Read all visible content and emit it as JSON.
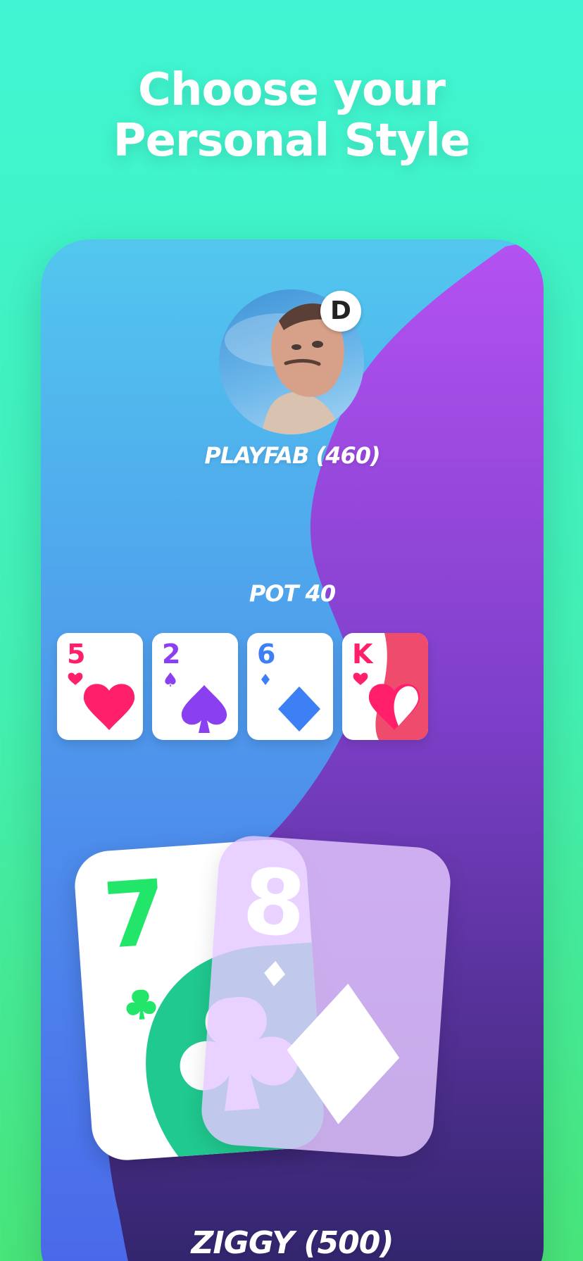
{
  "headline": {
    "line1": "Choose your",
    "line2": "Personal Style"
  },
  "opponent": {
    "name": "PLAYFAB (460)",
    "dealer_badge": "D",
    "avatar": "player-photo"
  },
  "pot": {
    "label": "POT 40"
  },
  "board_cards": [
    {
      "rank": "5",
      "suit": "hearts",
      "color": "#ff1f6a"
    },
    {
      "rank": "2",
      "suit": "spades",
      "color": "#8a3ff0"
    },
    {
      "rank": "6",
      "suit": "diamonds",
      "color": "#3d7ff5"
    },
    {
      "rank": "K",
      "suit": "hearts",
      "color": "#ff1f6a"
    }
  ],
  "hole_cards": [
    {
      "rank": "7",
      "suit": "clubs",
      "color": "#21e66a",
      "accent": "#20c98f"
    },
    {
      "rank": "8",
      "suit": "diamonds",
      "color": "#ffffff",
      "accent": "#e4c8ff"
    }
  ],
  "player": {
    "name": "ZIGGY  (500)"
  },
  "colors": {
    "background_top": "#3ff5d3",
    "background_bottom": "#48e57a",
    "table_blue": "#4e98ec",
    "purple_wave": "#7d3fc9"
  }
}
